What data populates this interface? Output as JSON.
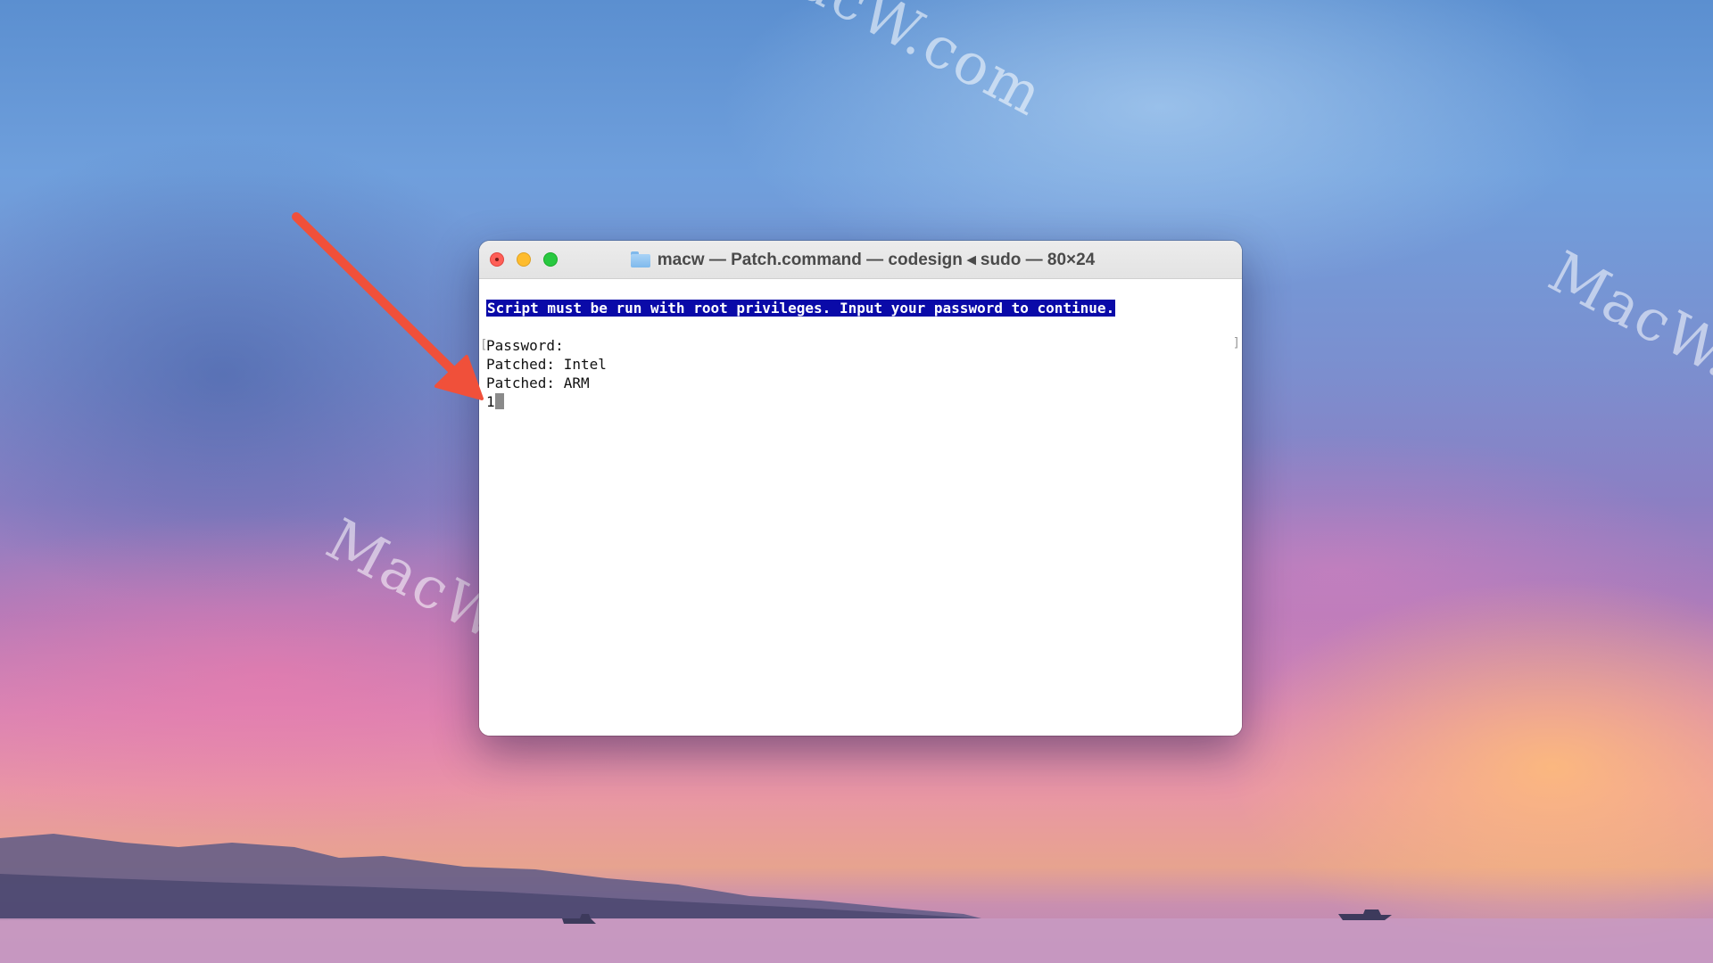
{
  "watermark": {
    "text": "MacW.com"
  },
  "window": {
    "title": "macw — Patch.command — codesign ◂ sudo — 80×24",
    "folder_icon": "folder-icon",
    "controls": {
      "close": "close-button",
      "minimize": "minimize-button",
      "maximize": "zoom-button"
    }
  },
  "terminal": {
    "highlighted_line": "Script must be run with root privileges. Input your password to continue.",
    "lines": [
      "Password:",
      "Patched: Intel",
      "Patched: ARM",
      "1"
    ],
    "colors": {
      "highlight_bg": "#0a0aa8",
      "highlight_fg": "#ffffff"
    }
  },
  "annotation": {
    "arrow_color": "#f0503a"
  }
}
